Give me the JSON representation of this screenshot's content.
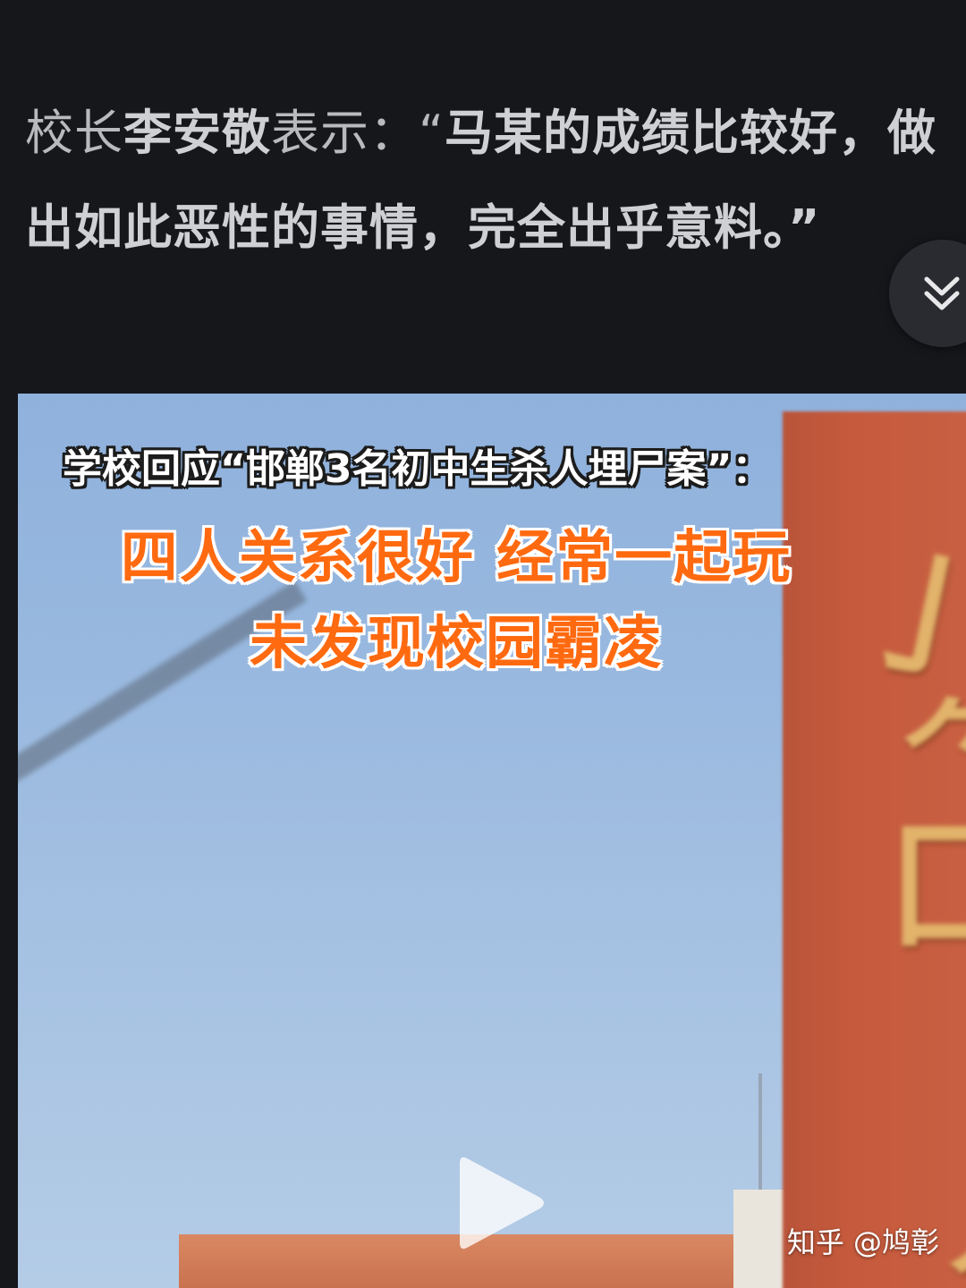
{
  "quote": {
    "line1": [
      {
        "text": "校长",
        "bold": false
      },
      {
        "text": "李安敬",
        "bold": true
      },
      {
        "text": "表示：“",
        "bold": false
      },
      {
        "text": "马某的成绩比较好，做",
        "bold": true
      }
    ],
    "line2": [
      {
        "text": "出如此恶性的事情，完全出乎意料。”",
        "bold": true
      }
    ]
  },
  "collapse_button": {
    "icon": "double-chevron-down-icon"
  },
  "video": {
    "caption_title": "学校回应“邯郸3名初中生杀人埋尸案”：",
    "headline_line1": "四人关系很好 经常一起玩",
    "headline_line2": "未发现校园霸凌",
    "play_icon": "play-icon",
    "watermark": "知乎 @鸠彰",
    "colors": {
      "headline": "#ff6a10",
      "sky": "#98b8df",
      "wall": "#c65a3c"
    }
  }
}
